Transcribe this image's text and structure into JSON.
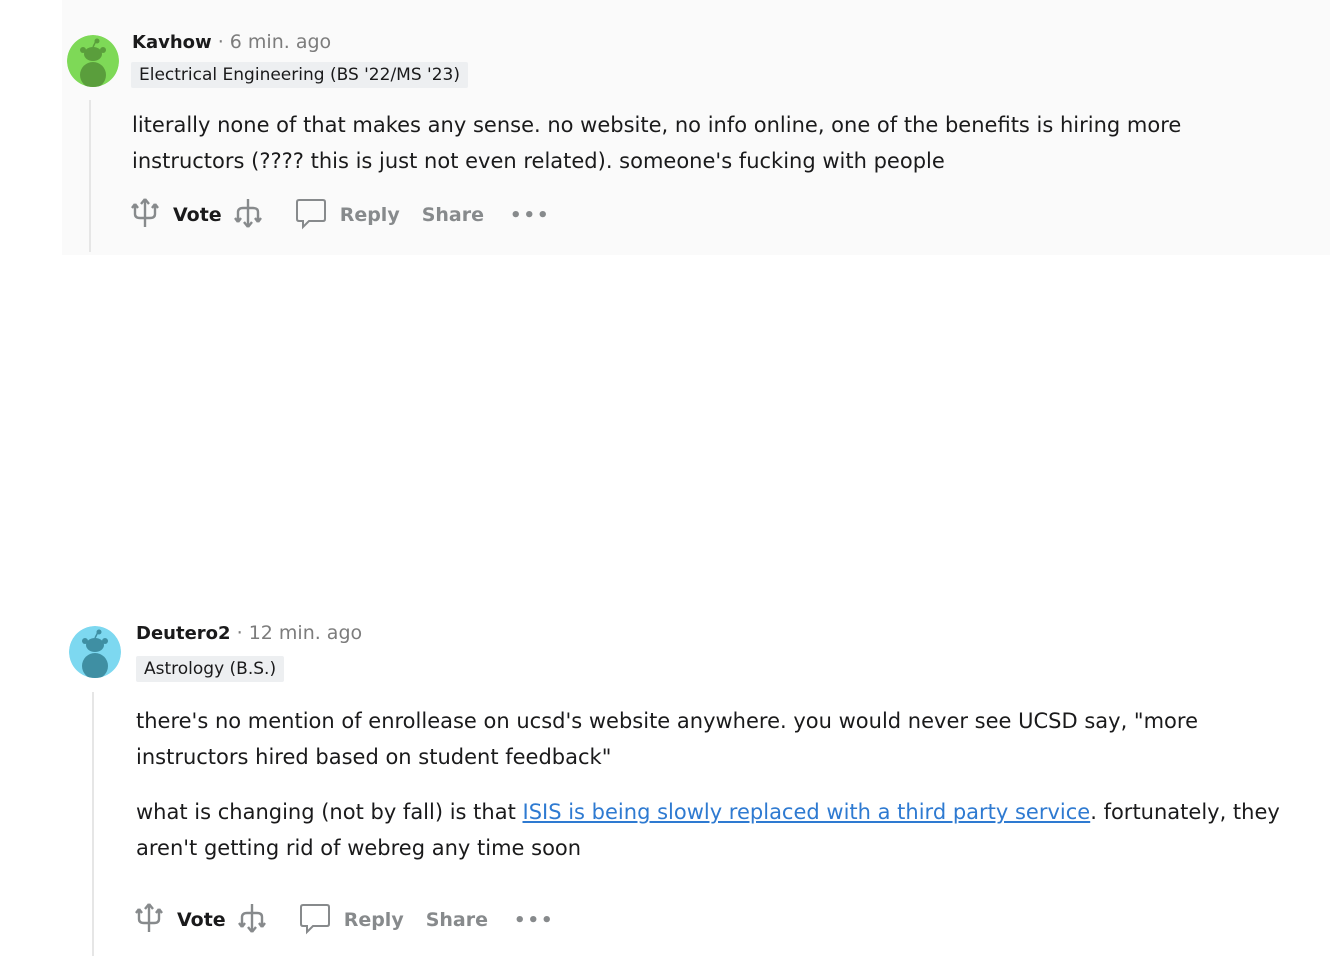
{
  "comments": [
    {
      "author": "Kavhow",
      "separator": "·",
      "time": "6 min. ago",
      "flair": "Electrical Engineering (BS '22/MS '23)",
      "avatar_color": "#7ed957",
      "paragraphs": [
        "literally none of that makes any sense. no website, no info online, one of the benefits is hiring more instructors (???? this is just not even related). someone's fucking with people"
      ],
      "actions": {
        "vote": "Vote",
        "reply": "Reply",
        "share": "Share",
        "more": "•••"
      }
    },
    {
      "author": "Deutero2",
      "separator": "·",
      "time": "12 min. ago",
      "flair": "Astrology (B.S.)",
      "avatar_color": "#7dd8f0",
      "paragraphs": [
        "there's no mention of enrollease on ucsd's website anywhere. you would never see UCSD say, \"more instructors hired based on student feedback\""
      ],
      "paragraph2_before": "what is changing (not by fall) is that ",
      "paragraph2_link": "ISIS is being slowly replaced with a third party service",
      "paragraph2_after": ". fortunately, they aren't getting rid of webreg any time soon",
      "actions": {
        "vote": "Vote",
        "reply": "Reply",
        "share": "Share",
        "more": "•••"
      }
    }
  ],
  "colors": {
    "link": "#2e7ad1",
    "meta_gray": "#7c7c7c",
    "action_gray": "#878a8c",
    "flair_bg": "#edeff1"
  }
}
